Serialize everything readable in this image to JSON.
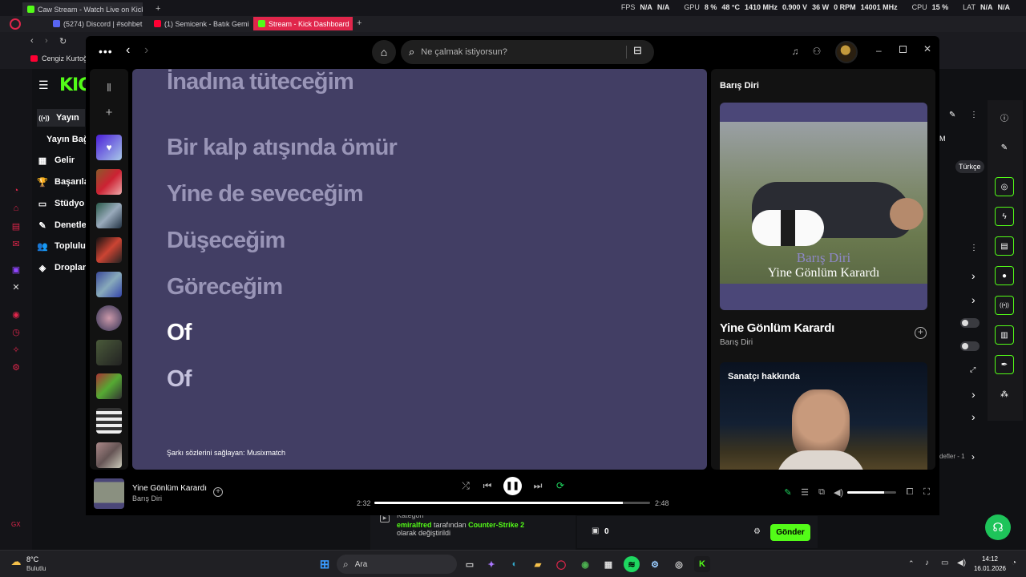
{
  "browser": {
    "tabs": [
      {
        "label": "Caw Stream - Watch Live on Kick",
        "color": "#53fc18"
      },
      {
        "label": "(5274) Discord | #sohbet",
        "color": "#5865f2"
      },
      {
        "label": "(1) Semicenk - Batık Gemi",
        "color": "#ff0033"
      },
      {
        "label": "Stream - Kick Dashboard",
        "color": "#53fc18"
      }
    ],
    "new_tab": "+",
    "bookmark": "Cengiz Kurtoğ",
    "stats": {
      "fps_label": "FPS",
      "fps1": "N/A",
      "fps2": "N/A",
      "gpu_label": "GPU",
      "gpu_load": "8 %",
      "gpu_temp": "48 °C",
      "gpu_clock": "1410 MHz",
      "gpu_volt": "0.900 V",
      "gpu_power": "36 W",
      "gpu_rpm": "0 RPM",
      "gpu_mem": "14001 MHz",
      "cpu_label": "CPU",
      "cpu_load": "15 %",
      "lat_label": "LAT",
      "lat1": "N/A",
      "lat2": "N/A"
    }
  },
  "kick": {
    "logo": "KICK",
    "nav": [
      {
        "icon": "((•))",
        "label": "Yayın"
      },
      {
        "icon": "",
        "label": "Yayın Bağ"
      },
      {
        "icon": "▦",
        "label": "Gelir"
      },
      {
        "icon": "🏆",
        "label": "Başarıla"
      },
      {
        "icon": "▭",
        "label": "Stüdyo"
      },
      {
        "icon": "✎",
        "label": "Denetle"
      },
      {
        "icon": "👥",
        "label": "Toplulu"
      },
      {
        "icon": "◈",
        "label": "Droplar"
      }
    ],
    "chips": [
      "M",
      "Türkçe"
    ],
    "chat_category": "Kategori",
    "chat_user": "emiralfred",
    "chat_by": "tarafından",
    "chat_game": "Counter-Strike 2",
    "chat_suffix": "olarak değiştirildi",
    "chest_count": "0",
    "send_label": "Gönder",
    "list_hint": "defler - 1",
    "gx_label": "GX"
  },
  "spotify": {
    "search_placeholder": "Ne çalmak istiyorsun?",
    "lyrics": [
      {
        "text": "İnadına tüteceğim",
        "active": false
      },
      {
        "text": "Bir kalp atışında ömür",
        "active": false
      },
      {
        "text": "Yine de seveceğim",
        "active": false
      },
      {
        "text": "Düşeceğim",
        "active": false
      },
      {
        "text": "Göreceğim",
        "active": false
      },
      {
        "text": "Of",
        "active": true
      },
      {
        "text": "Of",
        "active": false
      }
    ],
    "lyrics_provider": "Şarkı sözlerini sağlayan: Musixmatch",
    "right_panel": {
      "header": "Barış Diri",
      "album_artist_text": "Barış Diri",
      "album_song_text": "Yine Gönlüm Karardı",
      "song": "Yine Gönlüm Karardı",
      "artist": "Barış Diri",
      "about_title": "Sanatçı hakkında"
    },
    "player": {
      "title": "Yine Gönlüm Karardı",
      "artist": "Barış Diri",
      "current_time": "2:32",
      "total_time": "2:48",
      "progress": 0.9,
      "volume": 0.75,
      "accent": "#1ed760"
    }
  },
  "taskbar": {
    "temperature": "8°C",
    "weather": "Bulutlu",
    "search_placeholder": "Ara",
    "time": "14:12",
    "date": "16.01.2026"
  }
}
